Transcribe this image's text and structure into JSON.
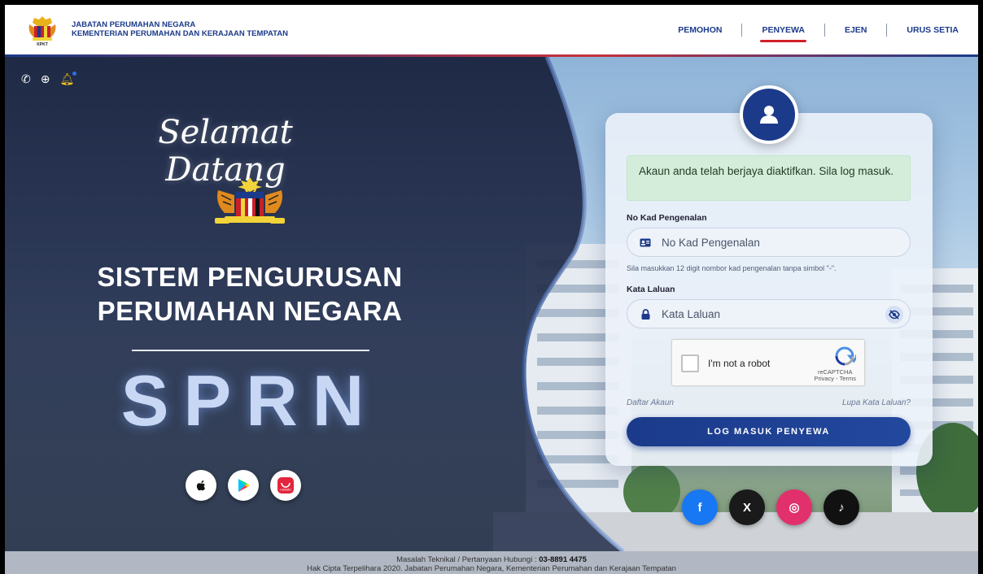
{
  "header": {
    "org_line1": "JABATAN PERUMAHAN NEGARA",
    "org_line2": "KEMENTERIAN PERUMAHAN DAN KERAJAAN TEMPATAN",
    "logo_caption": "KPKT",
    "nav": [
      {
        "label": "PEMOHON",
        "active": false
      },
      {
        "label": "PENYEWA",
        "active": true
      },
      {
        "label": "EJEN",
        "active": false
      },
      {
        "label": "URUS SETIA",
        "active": false
      }
    ]
  },
  "hero": {
    "welcome": "Selamat Datang",
    "title_line1": "SISTEM PENGURUSAN",
    "title_line2": "PERUMAHAN NEGARA",
    "acronym": "SPRN",
    "top_icons": [
      "phone-icon",
      "globe-icon",
      "bell-icon"
    ],
    "app_stores": [
      "apple-store-icon",
      "google-play-icon",
      "huawei-appgallery-icon"
    ]
  },
  "login": {
    "alert": "Akaun anda telah berjaya diaktifkan. Sila log masuk.",
    "ic_label": "No Kad Pengenalan",
    "ic_placeholder": "No Kad Pengenalan",
    "ic_help": "Sila masukkan 12 digit nombor kad pengenalan tanpa simbol \"-\".",
    "password_label": "Kata Laluan",
    "password_placeholder": "Kata Laluan",
    "captcha_text": "I'm not a robot",
    "captcha_brand": "reCAPTCHA",
    "captcha_links": "Privacy - Terms",
    "register_link": "Daftar Akaun",
    "forgot_link": "Lupa Kata Laluan?",
    "submit_label": "LOG MASUK PENYEWA"
  },
  "socials": [
    {
      "name": "facebook",
      "glyph": "f",
      "color": "#1877f2"
    },
    {
      "name": "x",
      "glyph": "X",
      "color": "#1a1a1a"
    },
    {
      "name": "instagram",
      "glyph": "◎",
      "color": "#e1306c"
    },
    {
      "name": "tiktok",
      "glyph": "♪",
      "color": "#111111"
    }
  ],
  "footer": {
    "line1_prefix": "Masalah Teknikal / Pertanyaan Hubungi : ",
    "phone": "03-8891 4475",
    "line2": "Hak Cipta Terpelihara 2020. Jabatan Perumahan Negara, Kementerian Perumahan dan Kerajaan Tempatan"
  },
  "colors": {
    "brand": "#1b3a8a",
    "accent_red": "#d0202a",
    "alert_bg": "#d4edda"
  }
}
